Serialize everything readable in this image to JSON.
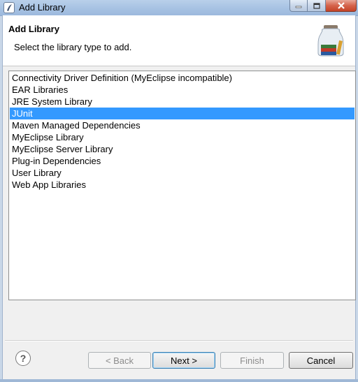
{
  "window": {
    "title": "Add Library",
    "icon": "eclipse-app-icon",
    "controls": [
      "minimize-icon",
      "maximize-icon",
      "close-icon"
    ],
    "close_color": "#c44327"
  },
  "header": {
    "title": "Add Library",
    "description": "Select the library type to add.",
    "image": "library-jar-icon"
  },
  "library_types": {
    "selected_index": 3,
    "selection_color": "#3399ff",
    "items": [
      "Connectivity Driver Definition (MyEclipse incompatible)",
      "EAR Libraries",
      "JRE System Library",
      "JUnit",
      "Maven Managed Dependencies",
      "MyEclipse Library",
      "MyEclipse Server Library",
      "Plug-in Dependencies",
      "User Library",
      "Web App Libraries"
    ]
  },
  "footer": {
    "help_icon": "help-icon",
    "help_label": "?",
    "back_label": "< Back",
    "next_label": "Next >",
    "finish_label": "Finish",
    "cancel_label": "Cancel"
  }
}
